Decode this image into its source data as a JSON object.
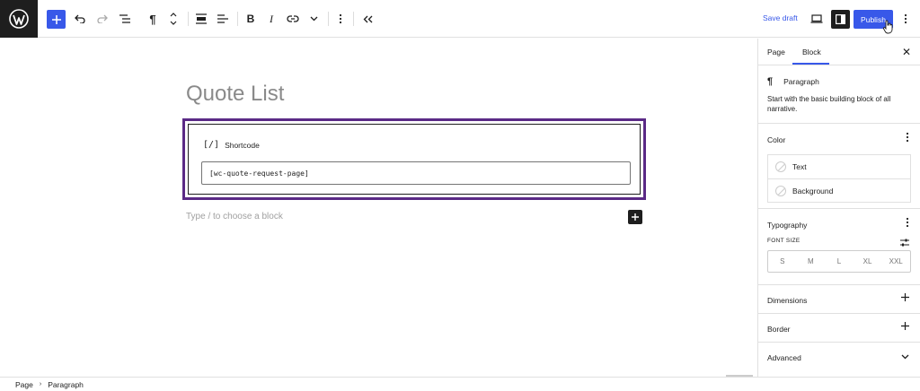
{
  "toolbar": {
    "save_draft": "Save draft",
    "publish": "Publish"
  },
  "editor": {
    "page_title": "Quote List",
    "shortcode_label": "Shortcode",
    "shortcode_icon_glyph": "[/]",
    "shortcode_value": "[wc-quote-request-page]",
    "appender_placeholder": "Type / to choose a block"
  },
  "breadcrumb": {
    "items": [
      "Page",
      "Paragraph"
    ],
    "separator": "›"
  },
  "sidebar": {
    "tabs": [
      "Page",
      "Block"
    ],
    "active_tab": "Block",
    "block": {
      "name": "Paragraph",
      "description": "Start with the basic building block of all narrative."
    },
    "color": {
      "title": "Color",
      "items": [
        "Text",
        "Background"
      ]
    },
    "typography": {
      "title": "Typography",
      "font_size_label": "FONT SIZE",
      "sizes": [
        "S",
        "M",
        "L",
        "XL",
        "XXL"
      ]
    },
    "panels": [
      "Dimensions",
      "Border",
      "Advanced"
    ]
  },
  "colors": {
    "accent": "#3858e9",
    "dark": "#1e1e1e",
    "block_outline": "#5b2a86"
  }
}
